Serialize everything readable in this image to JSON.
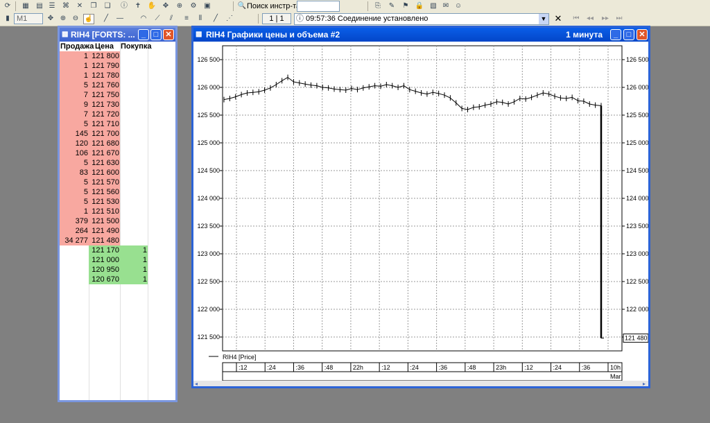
{
  "toolbar": {
    "search_label": "Поиск инстр-та",
    "search_value": "",
    "timeframe": "M1",
    "page_counter": "1 | 1",
    "status_message": "09:57:36  Соединение установлено",
    "icons": [
      "refresh-icon",
      "table-icon",
      "chart-icon",
      "list-icon",
      "connect-icon",
      "cross-icon",
      "window-icon",
      "info-icon",
      "pin-icon",
      "hand-icon",
      "drag-icon",
      "zoom-icon",
      "settings-icon",
      "grid-icon",
      "search-icon",
      "order-icon",
      "alert-icon",
      "lock-icon",
      "mail-icon",
      "user-icon",
      "close-icon",
      "first-icon",
      "prev-icon",
      "next-icon",
      "last-icon"
    ]
  },
  "orderbook": {
    "title": "RIH4 [FORTS: ...",
    "headers": [
      "Продажа",
      "Цена",
      "Покупка"
    ],
    "rows": [
      {
        "sell": "1",
        "price": "121 800",
        "buy": ""
      },
      {
        "sell": "1",
        "price": "121 790",
        "buy": ""
      },
      {
        "sell": "1",
        "price": "121 780",
        "buy": ""
      },
      {
        "sell": "5",
        "price": "121 760",
        "buy": ""
      },
      {
        "sell": "7",
        "price": "121 750",
        "buy": ""
      },
      {
        "sell": "9",
        "price": "121 730",
        "buy": ""
      },
      {
        "sell": "7",
        "price": "121 720",
        "buy": ""
      },
      {
        "sell": "5",
        "price": "121 710",
        "buy": ""
      },
      {
        "sell": "145",
        "price": "121 700",
        "buy": ""
      },
      {
        "sell": "120",
        "price": "121 680",
        "buy": ""
      },
      {
        "sell": "106",
        "price": "121 670",
        "buy": ""
      },
      {
        "sell": "5",
        "price": "121 630",
        "buy": ""
      },
      {
        "sell": "83",
        "price": "121 600",
        "buy": ""
      },
      {
        "sell": "5",
        "price": "121 570",
        "buy": ""
      },
      {
        "sell": "5",
        "price": "121 560",
        "buy": ""
      },
      {
        "sell": "5",
        "price": "121 530",
        "buy": ""
      },
      {
        "sell": "1",
        "price": "121 510",
        "buy": ""
      },
      {
        "sell": "379",
        "price": "121 500",
        "buy": ""
      },
      {
        "sell": "264",
        "price": "121 490",
        "buy": ""
      },
      {
        "sell": "34 277",
        "price": "121 480",
        "buy": ""
      },
      {
        "sell": "",
        "price": "121 170",
        "buy": "1"
      },
      {
        "sell": "",
        "price": "121 000",
        "buy": "1"
      },
      {
        "sell": "",
        "price": "120 950",
        "buy": "1"
      },
      {
        "sell": "",
        "price": "120 670",
        "buy": "1"
      }
    ]
  },
  "chartwin": {
    "title": "RIH4 Графики цены и объема #2",
    "interval": "1 минута",
    "legend": "RIH4 [Price]"
  },
  "chart_data": {
    "type": "line",
    "ylim": [
      121250,
      126750
    ],
    "yticks": [
      126500,
      126000,
      125500,
      125000,
      124500,
      124000,
      123500,
      123000,
      122500,
      122000,
      121500
    ],
    "ytick_labels": [
      "126 500",
      "126 000",
      "125 500",
      "125 000",
      "124 500",
      "124 000",
      "123 500",
      "123 000",
      "122 500",
      "122 000",
      "121 500"
    ],
    "last_price_label": "121 480",
    "x_labels": [
      ":12",
      ":24",
      ":36",
      ":48",
      "22h",
      ":12",
      ":24",
      ":36",
      ":48",
      "23h",
      ":12",
      ":24",
      ":36",
      "10h"
    ],
    "x_sublabel": "Mar",
    "grid": true,
    "series": [
      {
        "name": "RIH4 [Price]",
        "values": [
          125780,
          125800,
          125830,
          125870,
          125900,
          125910,
          125920,
          125950,
          125990,
          126050,
          126120,
          126180,
          126100,
          126080,
          126060,
          126040,
          126030,
          126000,
          125990,
          125970,
          125960,
          125950,
          125980,
          125960,
          125990,
          126010,
          126030,
          126020,
          126050,
          126030,
          126000,
          126030,
          125960,
          125930,
          125900,
          125880,
          125910,
          125890,
          125860,
          125810,
          125720,
          125620,
          125600,
          125640,
          125650,
          125680,
          125700,
          125740,
          125730,
          125700,
          125740,
          125800,
          125790,
          125820,
          125860,
          125900,
          125880,
          125840,
          125810,
          125800,
          125820,
          125760,
          125750,
          125700,
          125680,
          125670,
          121480
        ]
      }
    ]
  }
}
